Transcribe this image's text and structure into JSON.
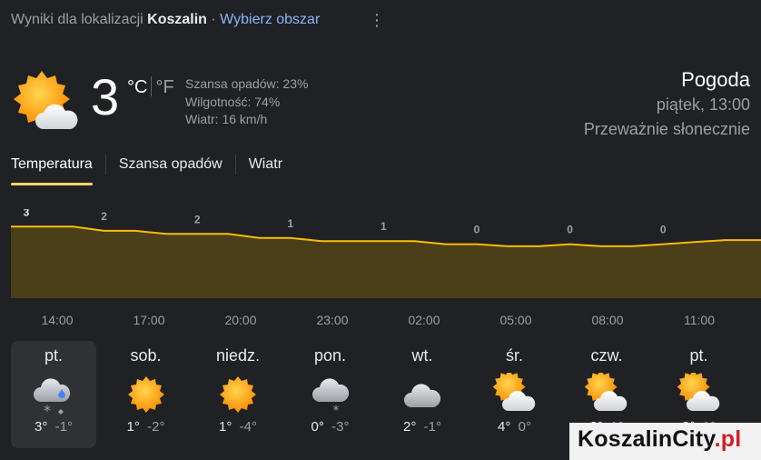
{
  "header": {
    "prefix": "Wyniki dla lokalizacji",
    "city": "Koszalin",
    "separator": "·",
    "choose_area": "Wybierz obszar",
    "menu_icon": "more-vert-icon"
  },
  "current": {
    "icon": "partly-sunny-icon",
    "temp": "3",
    "unit_c": "°C",
    "unit_f": "°F",
    "precip": "Szansa opadów: 23%",
    "humidity": "Wilgotność: 74%",
    "wind": "Wiatr: 16 km/h"
  },
  "summary": {
    "title": "Pogoda",
    "datetime": "piątek, 13:00",
    "condition": "Przeważnie słonecznie"
  },
  "tabs": [
    {
      "label": "Temperatura",
      "active": true
    },
    {
      "label": "Szansa opadów",
      "active": false
    },
    {
      "label": "Wiatr",
      "active": false
    }
  ],
  "chart_data": {
    "type": "area",
    "x": [
      "13:00",
      "14:00",
      "15:00",
      "16:00",
      "17:00",
      "18:00",
      "19:00",
      "20:00",
      "21:00",
      "22:00",
      "23:00",
      "00:00",
      "01:00",
      "02:00",
      "03:00",
      "04:00",
      "05:00",
      "06:00",
      "07:00",
      "08:00",
      "09:00",
      "10:00",
      "11:00",
      "12:00"
    ],
    "y": [
      3,
      3,
      3,
      2.6,
      2.6,
      2.3,
      2.3,
      2.3,
      1.9,
      1.9,
      1.6,
      1.6,
      1.6,
      1.6,
      1.3,
      1.3,
      1.1,
      1.1,
      1.3,
      1.1,
      1.1,
      1.3,
      1.5,
      1.7
    ],
    "value_labels": [
      {
        "x": "13:00",
        "label": "3"
      },
      {
        "x": "16:00",
        "label": "2"
      },
      {
        "x": "19:00",
        "label": "2"
      },
      {
        "x": "22:00",
        "label": "1"
      },
      {
        "x": "01:00",
        "label": "1"
      },
      {
        "x": "04:00",
        "label": "0"
      },
      {
        "x": "07:00",
        "label": "0"
      },
      {
        "x": "10:00",
        "label": "0"
      }
    ],
    "line_color": "#fbbc04",
    "fill_color": "#4a3f18",
    "ylim": [
      -2,
      4
    ]
  },
  "times": [
    "14:00",
    "17:00",
    "20:00",
    "23:00",
    "02:00",
    "05:00",
    "08:00",
    "11:00"
  ],
  "days": [
    {
      "name": "pt.",
      "icon": "cloud-sleet-icon",
      "hi": "3°",
      "lo": "-1°",
      "selected": true
    },
    {
      "name": "sob.",
      "icon": "sun-icon",
      "hi": "1°",
      "lo": "-2°",
      "selected": false
    },
    {
      "name": "niedz.",
      "icon": "sun-icon",
      "hi": "1°",
      "lo": "-4°",
      "selected": false
    },
    {
      "name": "pon.",
      "icon": "cloud-snow-icon",
      "hi": "0°",
      "lo": "-3°",
      "selected": false
    },
    {
      "name": "wt.",
      "icon": "cloud-icon",
      "hi": "2°",
      "lo": "-1°",
      "selected": false
    },
    {
      "name": "śr.",
      "icon": "partly-sunny-icon",
      "hi": "4°",
      "lo": "0°",
      "selected": false
    },
    {
      "name": "czw.",
      "icon": "partly-sunny-icon",
      "hi": "3°",
      "lo": "1°",
      "selected": false
    },
    {
      "name": "pt.",
      "icon": "partly-sunny-icon",
      "hi": "3°",
      "lo": "1°",
      "selected": false
    }
  ],
  "watermark": {
    "main": "KoszalinCity",
    "suffix": ".pl"
  },
  "colors": {
    "accent": "#fdd663",
    "link": "#8ab4f8",
    "background": "#202124",
    "watermark_red": "#d0202a"
  }
}
